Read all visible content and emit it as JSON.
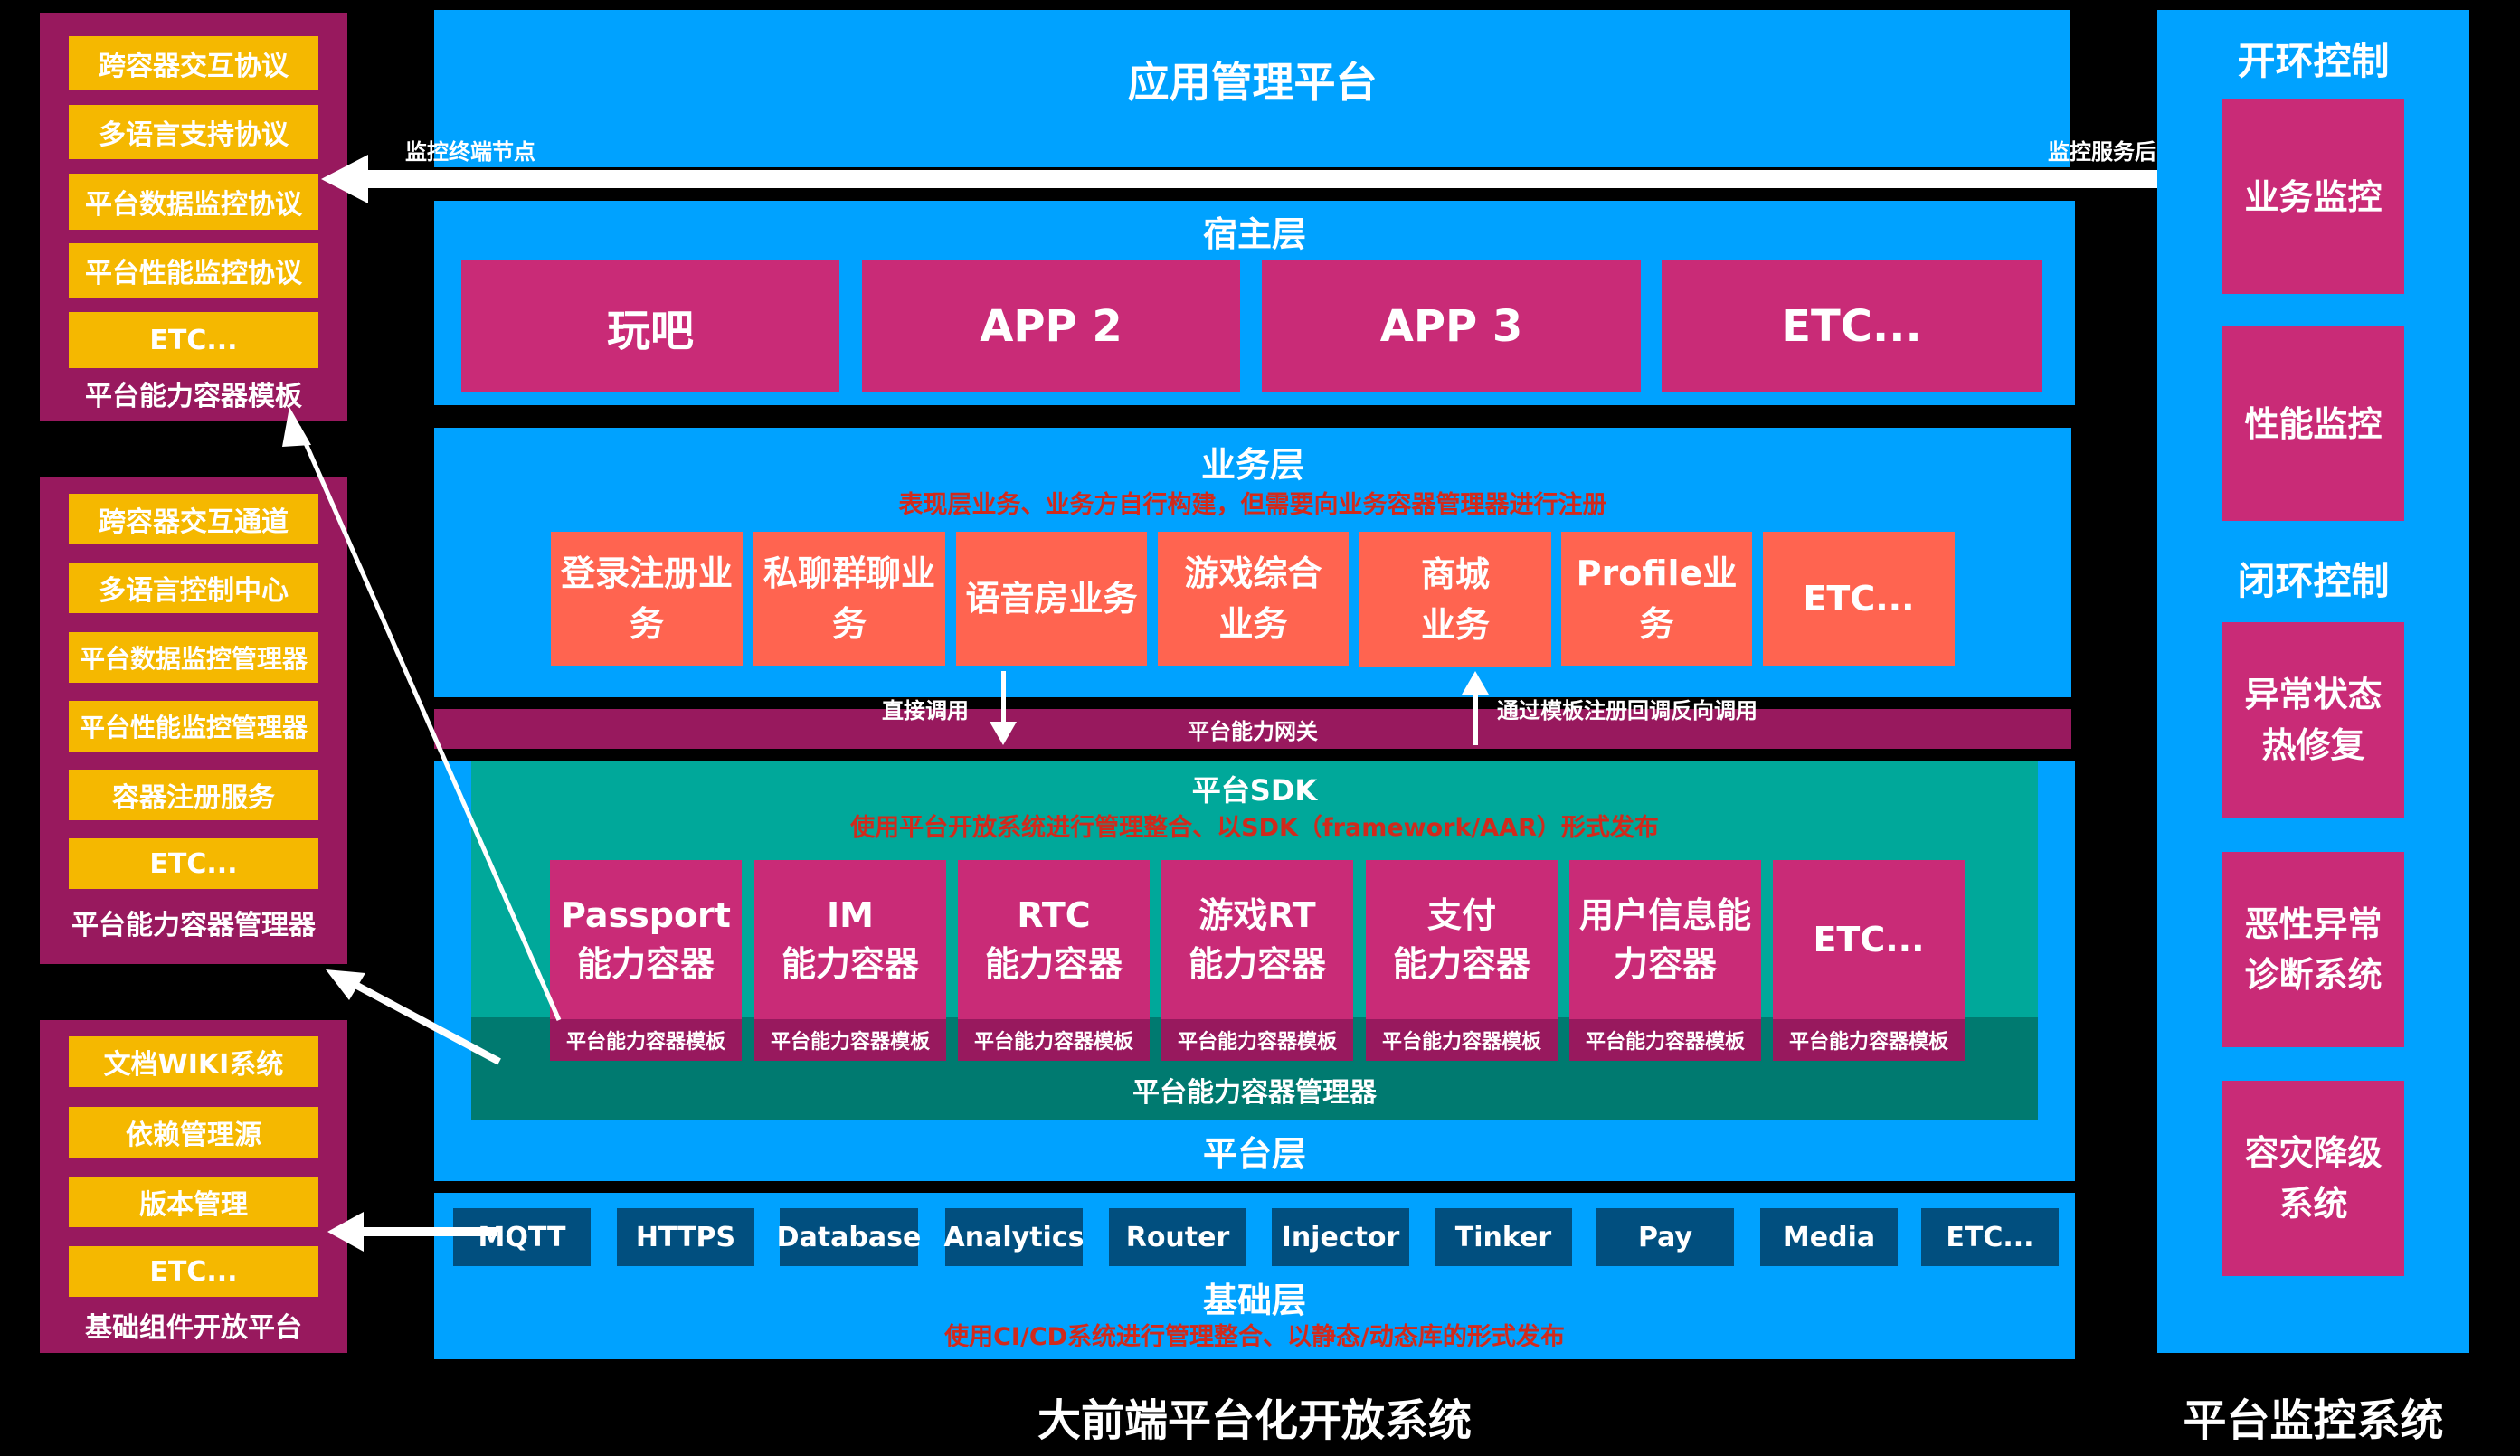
{
  "left_panels": [
    {
      "label": "平台能力容器模板",
      "items": [
        "跨容器交互协议",
        "多语言支持协议",
        "平台数据监控协议",
        "平台性能监控协议",
        "ETC..."
      ]
    },
    {
      "label": "平台能力容器管理器",
      "items": [
        "跨容器交互通道",
        "多语言控制中心",
        "平台数据监控管理器",
        "平台性能监控管理器",
        "容器注册服务",
        "ETC..."
      ]
    },
    {
      "label": "基础组件开放平台",
      "items": [
        "文档WIKI系统",
        "依赖管理源",
        "版本管理",
        "ETC..."
      ]
    }
  ],
  "app_management": {
    "title": "应用管理平台"
  },
  "monitor_arrow": {
    "left_label": "监控终端节点",
    "right_label": "监控服务后台"
  },
  "host_layer": {
    "title": "宿主层",
    "apps": [
      "玩吧",
      "APP 2",
      "APP 3",
      "ETC..."
    ]
  },
  "business_layer": {
    "title": "业务层",
    "subtitle": "表现层业务、业务方自行构建，但需要向业务容器管理器进行注册",
    "items": [
      [
        "登录注册业",
        "务"
      ],
      [
        "私聊群聊业",
        "务"
      ],
      [
        "语音房业务"
      ],
      [
        "游戏综合",
        "业务"
      ],
      [
        "商城",
        "业务"
      ],
      [
        "Profile业务"
      ],
      [
        "ETC..."
      ]
    ]
  },
  "gateway": {
    "label": "平台能力网关",
    "direct_call": "直接调用",
    "reverse_call": "通过模板注册回调反向调用"
  },
  "platform_layer": {
    "title": "平台层",
    "sdk_title": "平台SDK",
    "sdk_subtitle": "使用平台开放系统进行管理整合、以SDK（framework/AAR）形式发布",
    "containers": [
      {
        "lines": [
          "Passport",
          "能力容器"
        ],
        "template": "平台能力容器模板"
      },
      {
        "lines": [
          "IM",
          "能力容器"
        ],
        "template": "平台能力容器模板"
      },
      {
        "lines": [
          "RTC",
          "能力容器"
        ],
        "template": "平台能力容器模板"
      },
      {
        "lines": [
          "游戏RT",
          "能力容器"
        ],
        "template": "平台能力容器模板"
      },
      {
        "lines": [
          "支付",
          "能力容器"
        ],
        "template": "平台能力容器模板"
      },
      {
        "lines": [
          "用户信息能",
          "力容器"
        ],
        "template": "平台能力容器模板"
      },
      {
        "lines": [
          "ETC..."
        ],
        "template": "平台能力容器模板"
      }
    ],
    "manager_label": "平台能力容器管理器"
  },
  "base_layer": {
    "title": "基础层",
    "subtitle": "使用CI/CD系统进行管理整合、以静态/动态库的形式发布",
    "items": [
      "MQTT",
      "HTTPS",
      "Database",
      "Analytics",
      "Router",
      "Injector",
      "Tinker",
      "Pay",
      "Media",
      "ETC..."
    ]
  },
  "monitor_system": {
    "open_loop_title": "开环控制",
    "open_loop_items": [
      [
        "业务监控"
      ],
      [
        "性能监控"
      ]
    ],
    "closed_loop_title": "闭环控制",
    "closed_loop_items": [
      [
        "异常状态",
        "热修复"
      ],
      [
        "恶性异常",
        "诊断系统"
      ],
      [
        "容灾降级",
        "系统"
      ]
    ]
  },
  "captions": {
    "main": "大前端平台化开放系统",
    "monitor": "平台监控系统"
  },
  "colors": {
    "background": "#000000",
    "layer_blue": "#00a2ff",
    "panel_purple": "#98195e",
    "item_orange": "#f5b800",
    "box_magenta": "#c92b77",
    "business_coral": "#ff6450",
    "base_navy": "#014f7f",
    "sdk_teal": "#00a89a",
    "manager_teal": "#007a70",
    "subtitle_red": "#d12a1c"
  }
}
